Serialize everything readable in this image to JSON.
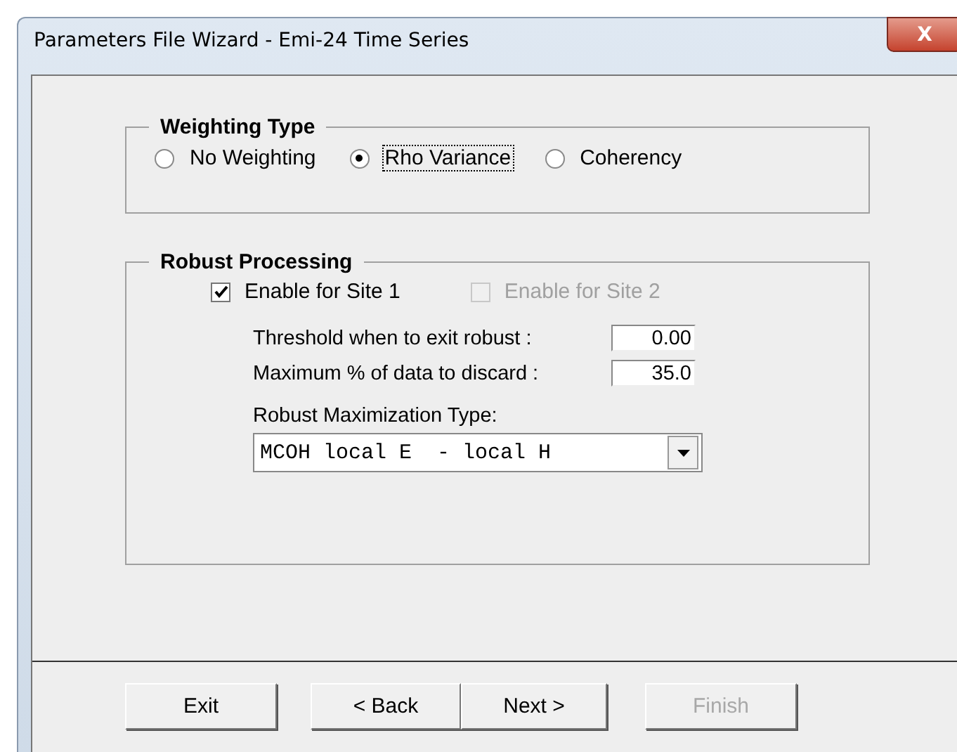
{
  "window": {
    "title": "Parameters File Wizard - Emi-24 Time Series",
    "close": "X"
  },
  "weighting": {
    "title": "Weighting Type",
    "options": [
      {
        "label": "No Weighting",
        "selected": false
      },
      {
        "label": "Rho Variance",
        "selected": true
      },
      {
        "label": "Coherency",
        "selected": false
      }
    ]
  },
  "robust": {
    "title": "Robust Processing",
    "sites": [
      {
        "label": "Enable for Site 1",
        "checked": true,
        "disabled": false
      },
      {
        "label": "Enable for Site 2",
        "checked": false,
        "disabled": true
      }
    ],
    "fields": [
      {
        "label": "Threshold when to exit robust :",
        "value": "0.00"
      },
      {
        "label": "Maximum % of data to discard :",
        "value": "35.0"
      }
    ],
    "max_type_label": "Robust Maximization Type:",
    "max_type_value": "MCOH local E  - local H"
  },
  "buttons": [
    {
      "label": "Exit",
      "disabled": false
    },
    {
      "label": "< Back",
      "disabled": false
    },
    {
      "label": "Next >",
      "disabled": false
    },
    {
      "label": "Finish",
      "disabled": true
    }
  ]
}
